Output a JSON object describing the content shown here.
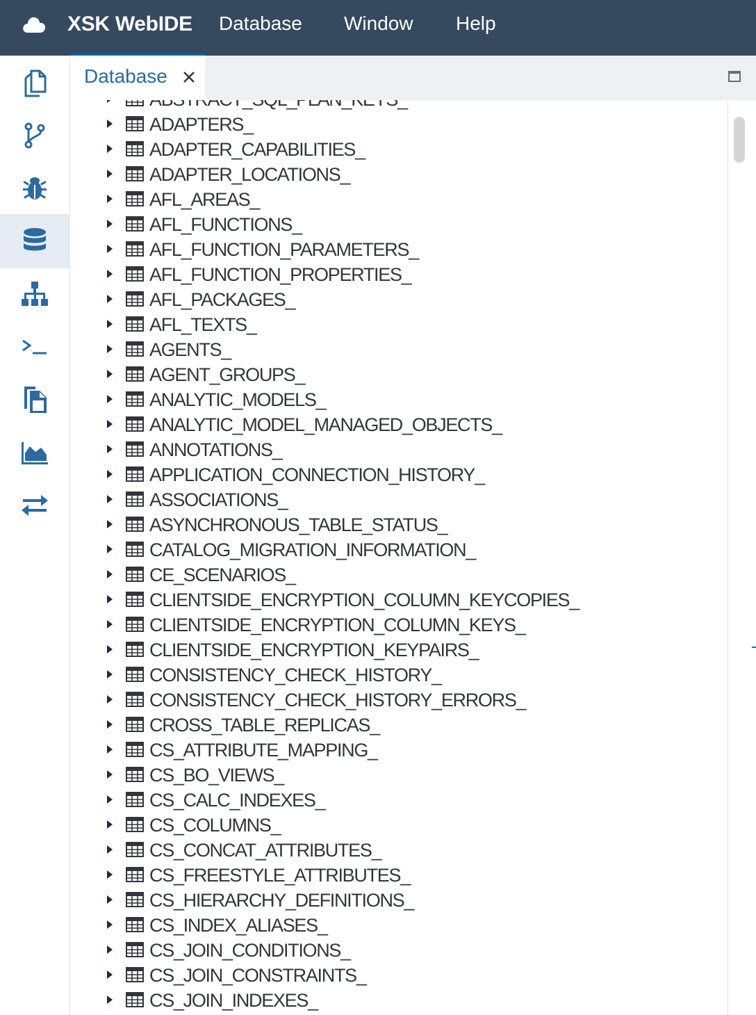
{
  "app": {
    "brand": "XSK WebIDE",
    "menu": [
      "Database",
      "Window",
      "Help"
    ]
  },
  "sidebar": {
    "items": [
      {
        "name": "workspace",
        "icon": "files-icon",
        "active": false
      },
      {
        "name": "git",
        "icon": "git-branch-icon",
        "active": false
      },
      {
        "name": "debugger",
        "icon": "bug-icon",
        "active": false
      },
      {
        "name": "database",
        "icon": "database-icon",
        "active": true
      },
      {
        "name": "repository",
        "icon": "sitemap-icon",
        "active": false
      },
      {
        "name": "terminal",
        "icon": "terminal-icon",
        "active": false
      },
      {
        "name": "documents",
        "icon": "copy-file-icon",
        "active": false
      },
      {
        "name": "monitoring",
        "icon": "area-chart-icon",
        "active": false
      },
      {
        "name": "transport",
        "icon": "exchange-icon",
        "active": false
      }
    ]
  },
  "tabs": [
    {
      "label": "Database",
      "active": true
    }
  ],
  "tree": {
    "items": [
      "ABSTRACT_SQL_PLAN_KEYS_",
      "ADAPTERS_",
      "ADAPTER_CAPABILITIES_",
      "ADAPTER_LOCATIONS_",
      "AFL_AREAS_",
      "AFL_FUNCTIONS_",
      "AFL_FUNCTION_PARAMETERS_",
      "AFL_FUNCTION_PROPERTIES_",
      "AFL_PACKAGES_",
      "AFL_TEXTS_",
      "AGENTS_",
      "AGENT_GROUPS_",
      "ANALYTIC_MODELS_",
      "ANALYTIC_MODEL_MANAGED_OBJECTS_",
      "ANNOTATIONS_",
      "APPLICATION_CONNECTION_HISTORY_",
      "ASSOCIATIONS_",
      "ASYNCHRONOUS_TABLE_STATUS_",
      "CATALOG_MIGRATION_INFORMATION_",
      "CE_SCENARIOS_",
      "CLIENTSIDE_ENCRYPTION_COLUMN_KEYCOPIES_",
      "CLIENTSIDE_ENCRYPTION_COLUMN_KEYS_",
      "CLIENTSIDE_ENCRYPTION_KEYPAIRS_",
      "CONSISTENCY_CHECK_HISTORY_",
      "CONSISTENCY_CHECK_HISTORY_ERRORS_",
      "CROSS_TABLE_REPLICAS_",
      "CS_ATTRIBUTE_MAPPING_",
      "CS_BO_VIEWS_",
      "CS_CALC_INDEXES_",
      "CS_COLUMNS_",
      "CS_CONCAT_ATTRIBUTES_",
      "CS_FREESTYLE_ATTRIBUTES_",
      "CS_HIERARCHY_DEFINITIONS_",
      "CS_INDEX_ALIASES_",
      "CS_JOIN_CONDITIONS_",
      "CS_JOIN_CONSTRAINTS_",
      "CS_JOIN_INDEXES_"
    ]
  },
  "colors": {
    "topbar": "#354a5f",
    "accent": "#0a6ed1",
    "icon": "#2c6aa0",
    "active_sidebar_bg": "#e5ecf3"
  }
}
